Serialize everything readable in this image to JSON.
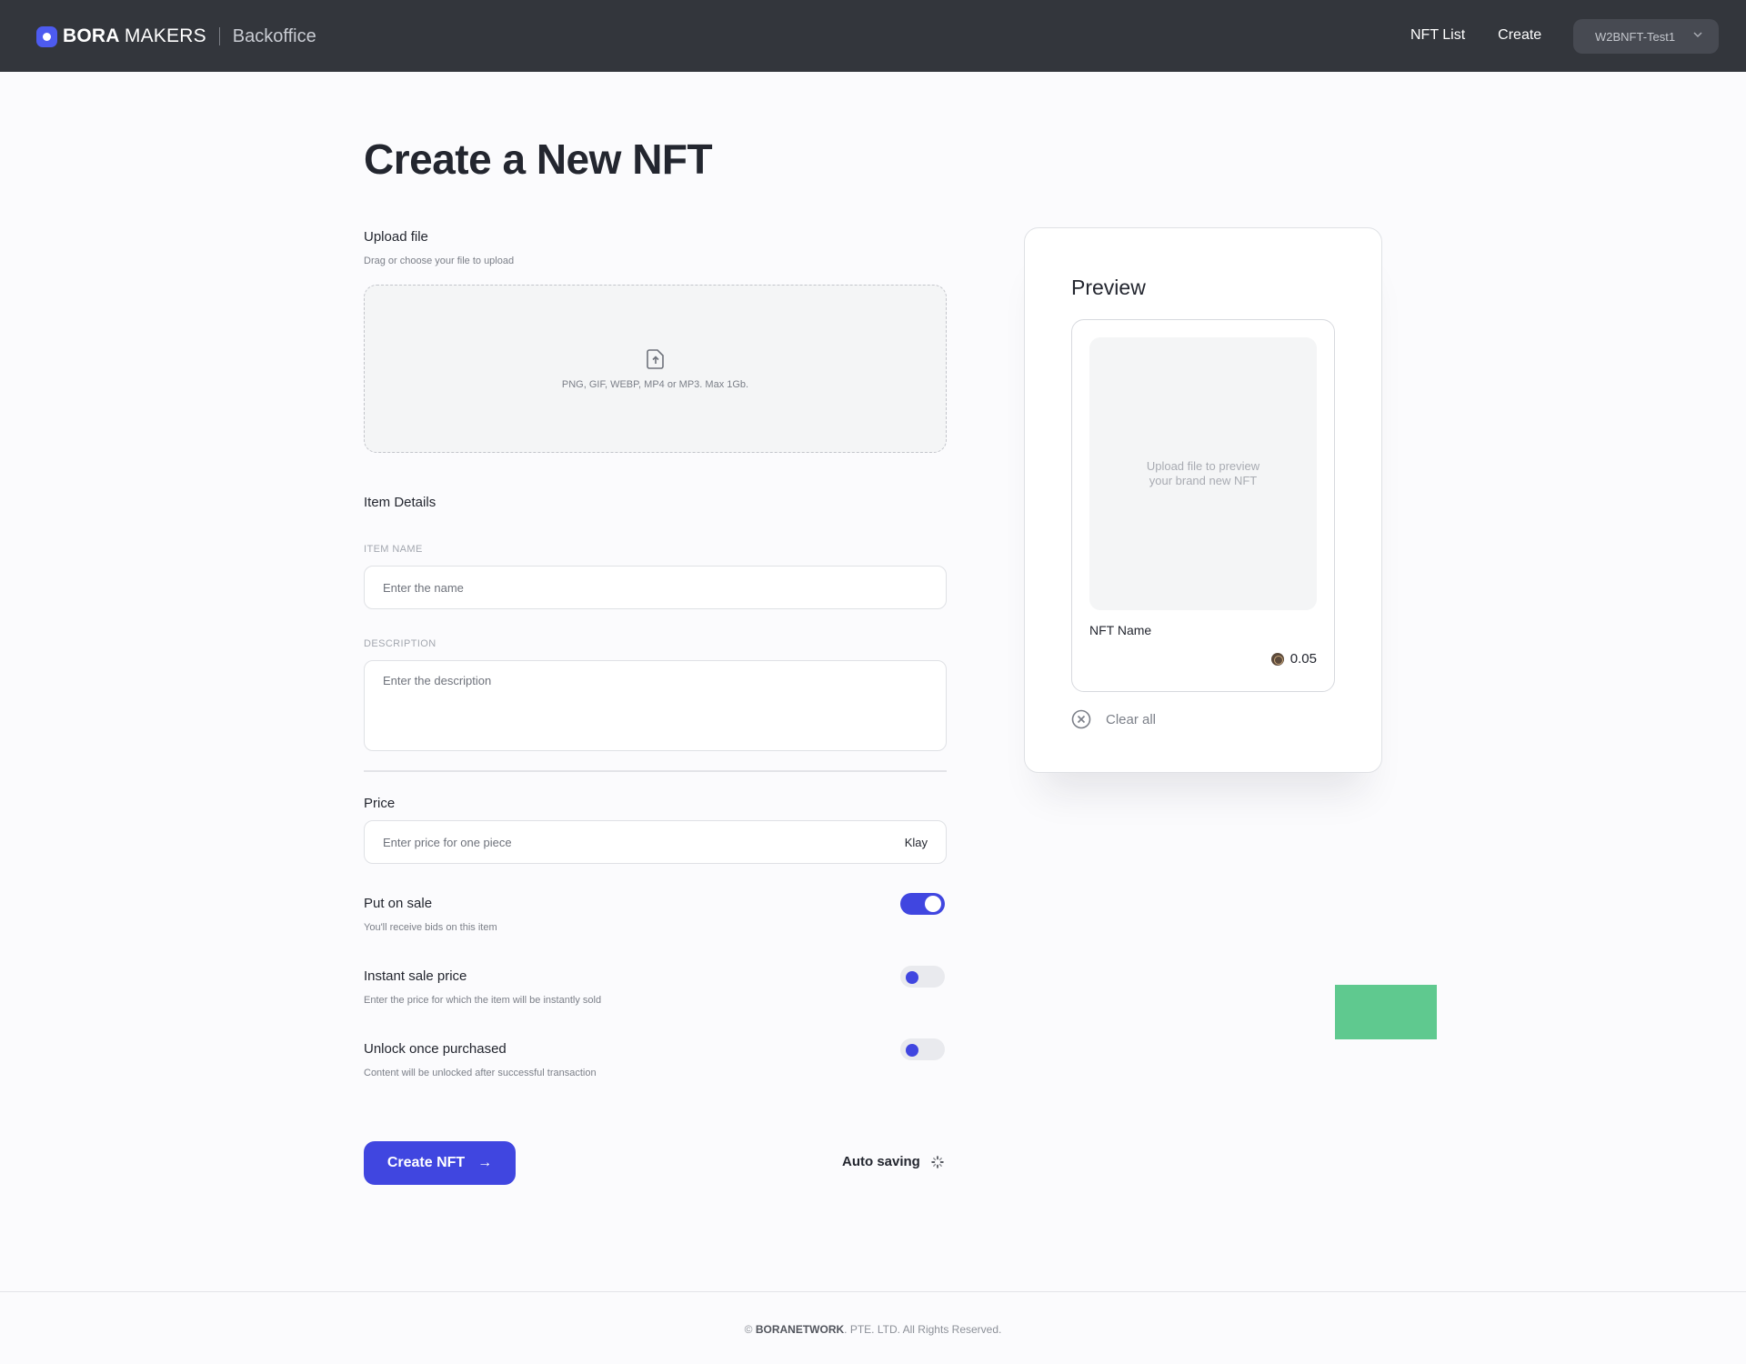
{
  "header": {
    "brand": "BORA",
    "brand_light": "MAKERS",
    "subtitle": "Backoffice",
    "nav": [
      "NFT List",
      "Create"
    ],
    "account": "W2BNFT-Test1"
  },
  "page_title": "Create a New NFT",
  "upload": {
    "label": "Upload file",
    "sublabel": "Drag or choose your file to upload",
    "hint": "PNG, GIF, WEBP, MP4 or MP3. Max 1Gb."
  },
  "item_details": {
    "heading": "Item Details",
    "name_label": "ITEM NAME",
    "name_placeholder": "Enter the name",
    "description_label": "DESCRIPTION",
    "description_placeholder": "Enter the description"
  },
  "price": {
    "label": "Price",
    "placeholder": "Enter price for one piece",
    "currency": "Klay"
  },
  "toggles": [
    {
      "title": "Put on sale",
      "desc": "You'll receive bids on this item",
      "on": true
    },
    {
      "title": "Instant sale price",
      "desc": "Enter the price for which the item will be instantly sold",
      "on": false
    },
    {
      "title": "Unlock once purchased",
      "desc": "Content will be unlocked after successful transaction",
      "on": false
    }
  ],
  "actions": {
    "create_label": "Create NFT",
    "create_arrow": "→",
    "autosave_label": "Auto saving"
  },
  "preview": {
    "title": "Preview",
    "placeholder_line1": "Upload file to preview",
    "placeholder_line2": "your brand new NFT",
    "nft_name": "NFT Name",
    "nft_price": "0.05",
    "clear_label": "Clear all"
  },
  "footer": {
    "copyright_symbol": "©",
    "company": "BORANETWORK",
    "rest": ". PTE. LTD. All Rights Reserved."
  },
  "colors": {
    "accent": "#4046e0",
    "header_bg": "#33363c",
    "green_block": "#5fc98f"
  }
}
